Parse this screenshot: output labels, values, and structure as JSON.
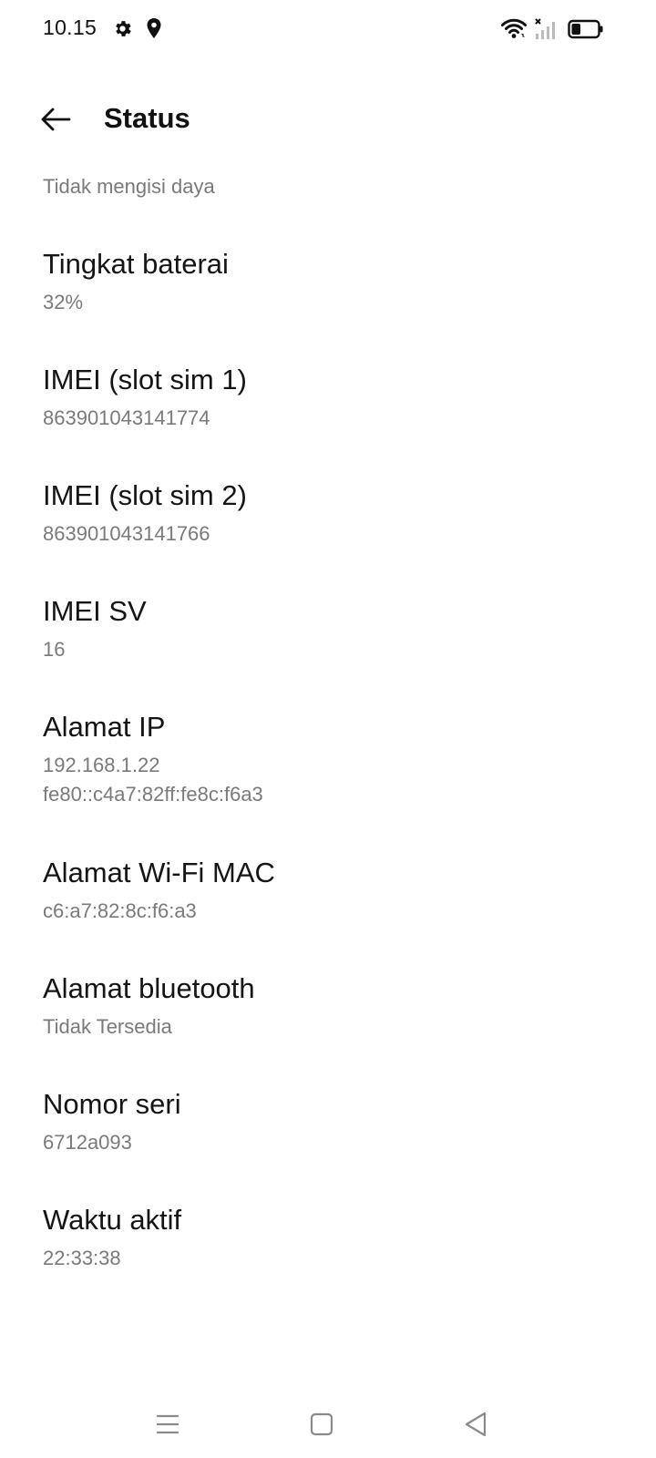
{
  "status_bar": {
    "time": "10.15",
    "icons": [
      "gear-icon",
      "location-icon",
      "wifi-icon",
      "signal-icon",
      "battery-icon"
    ]
  },
  "header": {
    "title": "Status"
  },
  "charging_status": "Tidak mengisi daya",
  "items": [
    {
      "title": "Tingkat baterai",
      "value": "32%"
    },
    {
      "title": "IMEI (slot sim 1)",
      "value": "863901043141774"
    },
    {
      "title": "IMEI (slot sim 2)",
      "value": "863901043141766"
    },
    {
      "title": "IMEI SV",
      "value": "16"
    },
    {
      "title": "Alamat IP",
      "value": "192.168.1.22",
      "value2": "fe80::c4a7:82ff:fe8c:f6a3"
    },
    {
      "title": "Alamat Wi-Fi MAC",
      "value": "c6:a7:82:8c:f6:a3"
    },
    {
      "title": "Alamat bluetooth",
      "value": "Tidak Tersedia"
    },
    {
      "title": "Nomor seri",
      "value": "6712a093"
    },
    {
      "title": "Waktu aktif",
      "value": "22:33:38"
    }
  ],
  "nav": {
    "buttons": [
      "menu-icon",
      "home-icon",
      "back-triangle-icon"
    ]
  },
  "colors": {
    "background": "#ffffff",
    "primary_text": "#111111",
    "secondary_text": "#7a7a7a"
  }
}
